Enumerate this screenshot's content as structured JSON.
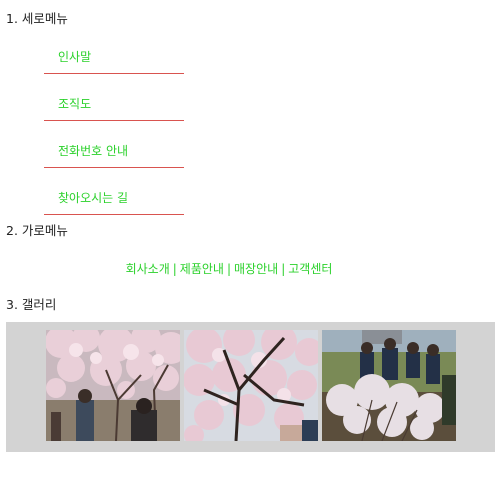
{
  "sections": {
    "vertical_title": "1. 세로메뉴",
    "horizontal_title": "2. 가로메뉴",
    "gallery_title": "3. 갤러리"
  },
  "vertical_menu": [
    {
      "label": "인사말"
    },
    {
      "label": "조직도"
    },
    {
      "label": "전화번호 안내"
    },
    {
      "label": "찾아오시는 길"
    }
  ],
  "horizontal_menu": [
    {
      "label": "회사소개"
    },
    {
      "label": "제품안내"
    },
    {
      "label": "매장안내"
    },
    {
      "label": "고객센터"
    }
  ],
  "separator": "|",
  "colors": {
    "menu_link": "#2bd12b",
    "menu_underline": "#d9534f",
    "gallery_bg": "#d3d3d3"
  },
  "gallery": [
    {
      "subject": "cherry-blossom-people-photo"
    },
    {
      "subject": "cherry-blossom-tree-photo"
    },
    {
      "subject": "group-gathering-shrub-photo"
    }
  ]
}
